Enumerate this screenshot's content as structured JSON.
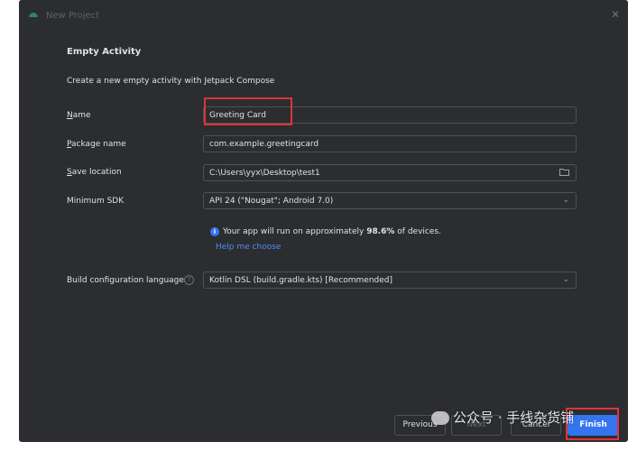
{
  "window": {
    "title": "New Project"
  },
  "page": {
    "heading": "Empty Activity",
    "description": "Create a new empty activity with Jetpack Compose"
  },
  "form": {
    "name": {
      "label_accel": "N",
      "label_rest": "ame",
      "value": "Greeting Card"
    },
    "package": {
      "label_accel": "P",
      "label_rest": "ackage name",
      "value": "com.example.greetingcard"
    },
    "location": {
      "label_accel": "S",
      "label_rest": "ave location",
      "value": "C:\\Users\\yyx\\Desktop\\test1"
    },
    "min_sdk": {
      "label": "Minimum SDK",
      "value": "API 24 (\"Nougat\"; Android 7.0)"
    },
    "build_lang": {
      "label": "Build configuration language",
      "value": "Kotlin DSL (build.gradle.kts) [Recommended]"
    }
  },
  "info": {
    "prefix": "Your app will run on approximately ",
    "percent": "98.6%",
    "suffix": " of devices.",
    "help_link": "Help me choose"
  },
  "buttons": {
    "previous": "Previous",
    "next": "Next",
    "cancel": "Cancel",
    "finish": "Finish"
  },
  "watermark": "公众号 · 手线杂货铺",
  "colors": {
    "background": "#2b2d30",
    "accent": "#3574f0",
    "link": "#548af7",
    "highlight": "#e0333a"
  }
}
